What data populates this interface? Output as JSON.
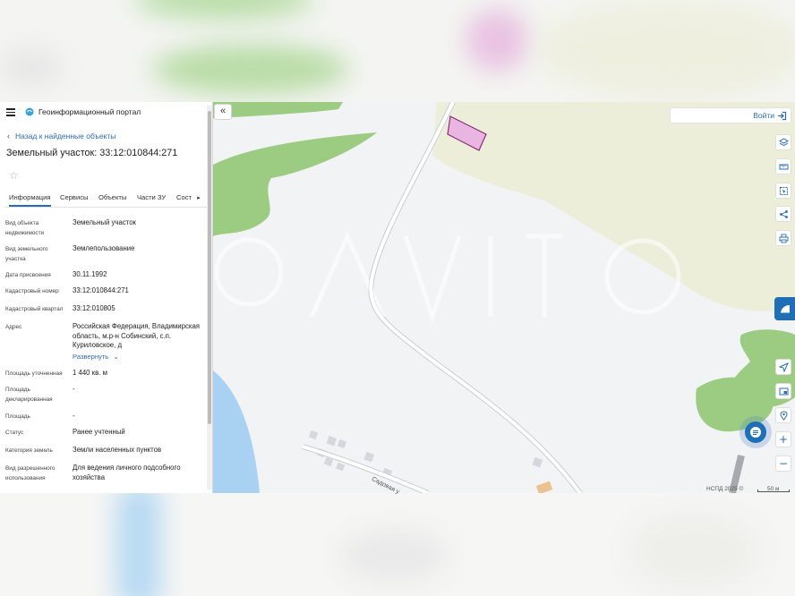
{
  "header": {
    "portal_title": "Геоинформационный портал"
  },
  "navigation": {
    "back_label": "Назад к найденные объекты"
  },
  "object": {
    "title": "Земельный участок: 33:12:010844:271"
  },
  "tabs": [
    {
      "label": "Информация",
      "active": true
    },
    {
      "label": "Сервисы",
      "active": false
    },
    {
      "label": "Объекты",
      "active": false
    },
    {
      "label": "Части ЗУ",
      "active": false
    },
    {
      "label": "Сост",
      "active": false
    }
  ],
  "details": [
    {
      "label": "Вид объекта недвижимости",
      "value": "Земельный участок"
    },
    {
      "label": "Вид земельного участка",
      "value": "Землепользование"
    },
    {
      "label": "Дата присвоения",
      "value": "30.11.1992"
    },
    {
      "label": "Кадастровый номер",
      "value": "33:12:010844:271"
    },
    {
      "label": "Кадастровый квартал",
      "value": "33:12:010805"
    },
    {
      "label": "Адрес",
      "value": "Российская Федерация, Владимирская область, м.р-н Собинский, с.п. Куриловское, д"
    },
    {
      "label": "Площадь уточненная",
      "value": "1 440 кв. м"
    },
    {
      "label": "Площадь декларированная",
      "value": "-"
    },
    {
      "label": "Площадь",
      "value": "-"
    },
    {
      "label": "Статус",
      "value": "Ранее учтенный"
    },
    {
      "label": "Категория земель",
      "value": "Земли населенных пунктов"
    },
    {
      "label": "Вид разрешенного использования",
      "value": "Для ведения личного подсобного хозяйства"
    }
  ],
  "expand_label": "Развернуть",
  "login_label": "Войти",
  "map": {
    "street_label": "Садовая у",
    "attribution": "НСПД 2025 ©",
    "scale_label": "50 м"
  },
  "colors": {
    "accent": "#2b6cb0",
    "vegetation": "#9ccc82",
    "field": "#eceed9",
    "water": "#a9d2f2",
    "parcel_fill": "#e8b6e0",
    "parcel_stroke": "#8a2d7c"
  },
  "icons": {
    "tools": [
      "layers-icon",
      "ruler-icon",
      "select-area-icon",
      "share-icon",
      "print-icon"
    ],
    "controls": [
      "locate-icon",
      "minimap-icon",
      "geo-pin-icon",
      "zoom-in-icon",
      "zoom-out-icon"
    ]
  }
}
